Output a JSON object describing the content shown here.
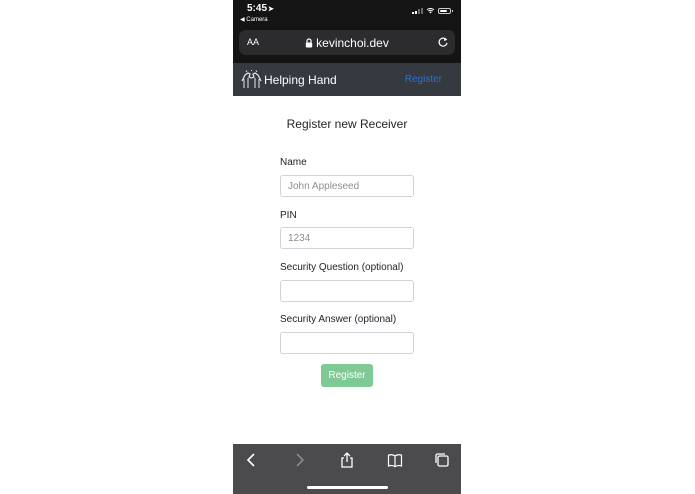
{
  "status": {
    "time": "5:45",
    "back_app": "◀ Camera",
    "battery_level": 0.75
  },
  "browser": {
    "aa_label": "AA",
    "url": "kevinchoi.dev"
  },
  "navbar": {
    "brand": "Helping Hand",
    "register_link": "Register"
  },
  "form": {
    "title": "Register new Receiver",
    "name_label": "Name",
    "name_placeholder": "John Appleseed",
    "pin_label": "PIN",
    "pin_placeholder": "1234",
    "question_label": "Security Question (optional)",
    "question_value": "",
    "answer_label": "Security Answer (optional)",
    "answer_value": "",
    "submit_label": "Register"
  },
  "toolbar": {
    "items": [
      "back-icon",
      "forward-icon",
      "share-icon",
      "bookmarks-icon",
      "tabs-icon"
    ]
  },
  "colors": {
    "navbar": "#343a40",
    "register_button": "#7fc995",
    "nav_link": "#2f6fd0",
    "toolbar": "#4b4b4d"
  }
}
